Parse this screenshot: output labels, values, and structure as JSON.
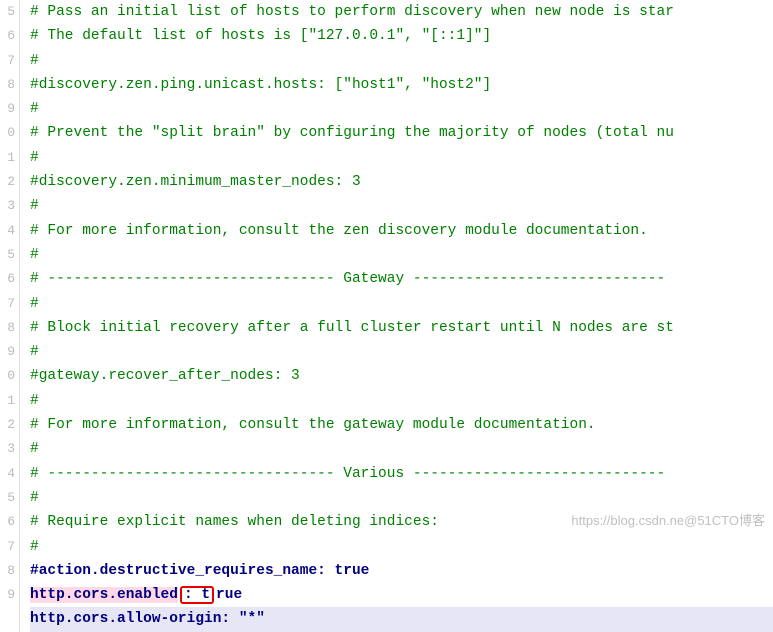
{
  "gutter": [
    "5",
    "6",
    "7",
    "8",
    "9",
    "0",
    "1",
    "2",
    "3",
    "4",
    "5",
    "6",
    "7",
    "8",
    "9",
    "0",
    "1",
    "2",
    "3",
    "4",
    "5",
    "6",
    "7",
    "8",
    "9"
  ],
  "lines": {
    "l0": "# Pass an initial list of hosts to perform discovery when new node is star",
    "l1": "# The default list of hosts is [\"127.0.0.1\", \"[::1]\"]",
    "l2": "#",
    "l3": "#discovery.zen.ping.unicast.hosts: [\"host1\", \"host2\"]",
    "l4": "#",
    "l5": "# Prevent the \"split brain\" by configuring the majority of nodes (total nu",
    "l6": "#",
    "l7": "#discovery.zen.minimum_master_nodes: 3",
    "l8": "#",
    "l9": "# For more information, consult the zen discovery module documentation.",
    "l10": "#",
    "l11": "# --------------------------------- Gateway -----------------------------",
    "l12": "#",
    "l13": "# Block initial recovery after a full cluster restart until N nodes are st",
    "l14": "#",
    "l15": "#gateway.recover_after_nodes: 3",
    "l16": "#",
    "l17": "# For more information, consult the gateway module documentation.",
    "l18": "#",
    "l19": "# --------------------------------- Various -----------------------------",
    "l20": "#",
    "l21": "# Require explicit names when deleting indices:",
    "l22": "#"
  },
  "settings": {
    "s1_key": "#action.destructive_requires_name:",
    "s1_val": " true",
    "s2_key": "http.cors.enabled",
    "s2_mid": ": t",
    "s2_val": "rue",
    "s3_key": "http.cors.allow-origin:",
    "s3_val": " \"*\""
  },
  "watermark": "https://blog.csdn.ne@51CTO博客"
}
